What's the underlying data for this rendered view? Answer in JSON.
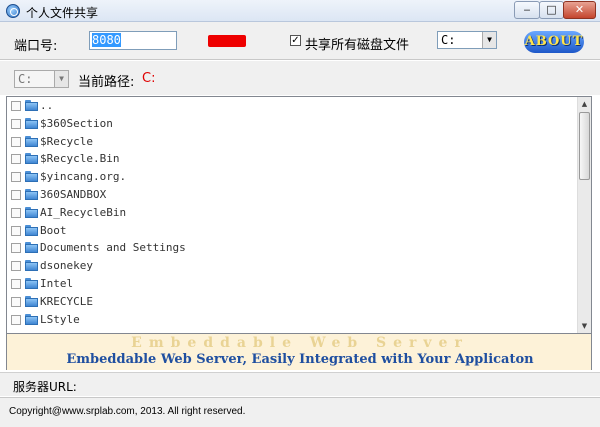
{
  "window": {
    "title": "个人文件共享",
    "minimize_label": "‒",
    "maximize_label": "□",
    "close_label": "✕"
  },
  "toolbar": {
    "port_label": "端口号:",
    "port_value": "8080",
    "status_color": "#ee0000",
    "share_all_checked": true,
    "share_all_check_glyph": "✓",
    "share_all_label": "共享所有磁盘文件",
    "drive_value": "C:",
    "about_label": "ABOUT"
  },
  "path_row": {
    "drive_value": "C:",
    "current_path_label": "当前路径:",
    "current_path_value": "C:"
  },
  "file_list": {
    "items": [
      "..",
      "$360Section",
      "$Recycle",
      "$Recycle.Bin",
      "$yincang.org.",
      "360SANDBOX",
      "AI_RecycleBin",
      "Boot",
      "Documents and Settings",
      "dsonekey",
      "Intel",
      "KRECYCLE",
      "LStyle"
    ]
  },
  "banner": {
    "line1": "Embeddable Web Server",
    "line2": "Embeddable Web Server, Easily Integrated with Your Applicaton"
  },
  "footer": {
    "server_url_label": "服务器URL:",
    "copyright": "Copyright@www.srplab.com, 2013.  All right reserved."
  }
}
